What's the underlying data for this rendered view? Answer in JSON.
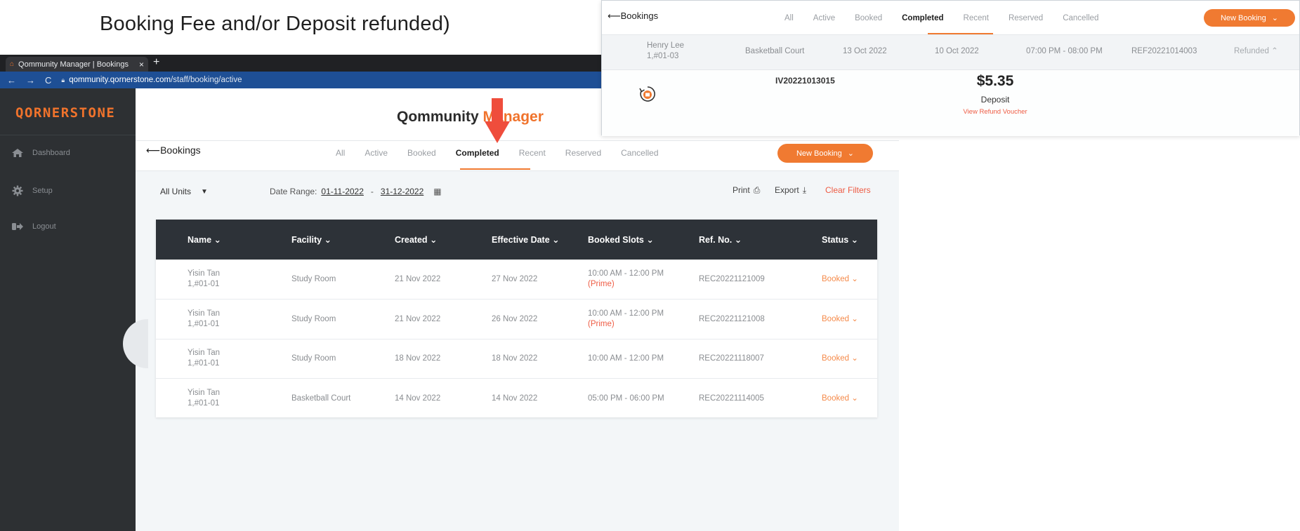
{
  "caption": "Booking Fee and/or Deposit refunded)",
  "browser": {
    "tab_title": "Qommunity Manager | Bookings",
    "url_host": "qommunity.qornerstone.com",
    "url_path": "/staff/booking/active"
  },
  "sidebar": {
    "logo": "QORNERSTONE",
    "items": [
      {
        "label": "Dashboard",
        "icon": "home-icon"
      },
      {
        "label": "Setup",
        "icon": "gear-icon"
      },
      {
        "label": "Logout",
        "icon": "logout-icon"
      }
    ]
  },
  "header": {
    "app_title_part1": "Qommunity ",
    "app_title_part2": "Manager"
  },
  "bookings": {
    "back_label": "Bookings",
    "tabs": [
      "All",
      "Active",
      "Booked",
      "Completed",
      "Recent",
      "Reserved",
      "Cancelled"
    ],
    "active_tab": "Completed",
    "new_booking_label": "New Booking"
  },
  "filters": {
    "units": "All Units",
    "date_range_label": "Date Range:",
    "date_from": "01-11-2022",
    "date_sep": "-",
    "date_to": "31-12-2022",
    "print": "Print",
    "export": "Export",
    "clear": "Clear Filters"
  },
  "table": {
    "columns": [
      "Name",
      "Facility",
      "Created",
      "Effective Date",
      "Booked Slots",
      "Ref. No.",
      "Status"
    ],
    "rows": [
      {
        "name": "Yisin Tan",
        "unit": "1,#01-01",
        "facility": "Study Room",
        "created": "21 Nov 2022",
        "effective": "27 Nov 2022",
        "slot": "10:00 AM - 12:00 PM",
        "prime": "(Prime)",
        "ref": "REC20221121009",
        "status": "Booked"
      },
      {
        "name": "Yisin Tan",
        "unit": "1,#01-01",
        "facility": "Study Room",
        "created": "21 Nov 2022",
        "effective": "26 Nov 2022",
        "slot": "10:00 AM - 12:00 PM",
        "prime": "(Prime)",
        "ref": "REC20221121008",
        "status": "Booked"
      },
      {
        "name": "Yisin Tan",
        "unit": "1,#01-01",
        "facility": "Study Room",
        "created": "18 Nov 2022",
        "effective": "18 Nov 2022",
        "slot": "10:00 AM - 12:00 PM",
        "prime": "",
        "ref": "REC20221118007",
        "status": "Booked"
      },
      {
        "name": "Yisin Tan",
        "unit": "1,#01-01",
        "facility": "Basketball Court",
        "created": "14 Nov 2022",
        "effective": "14 Nov 2022",
        "slot": "05:00 PM - 06:00 PM",
        "prime": "",
        "ref": "REC20221114005",
        "status": "Booked"
      }
    ]
  },
  "inset": {
    "back_label": "Bookings",
    "tabs": [
      "All",
      "Active",
      "Booked",
      "Completed",
      "Recent",
      "Reserved",
      "Cancelled"
    ],
    "active_tab": "Completed",
    "new_booking_label": "New Booking",
    "row": {
      "name": "Henry Lee",
      "unit": "1,#01-03",
      "facility": "Basketball Court",
      "created": "13 Oct 2022",
      "effective": "10 Oct 2022",
      "slot": "07:00 PM - 08:00 PM",
      "ref": "REF20221014003",
      "status": "Refunded"
    },
    "detail": {
      "invoice": "IV20221013015",
      "amount": "$5.35",
      "type": "Deposit",
      "link": "View Refund Voucher"
    }
  },
  "colors": {
    "accent": "#f0732c",
    "danger": "#ee5b43",
    "sidebar": "#2d3033",
    "table_header": "#2d3238"
  }
}
